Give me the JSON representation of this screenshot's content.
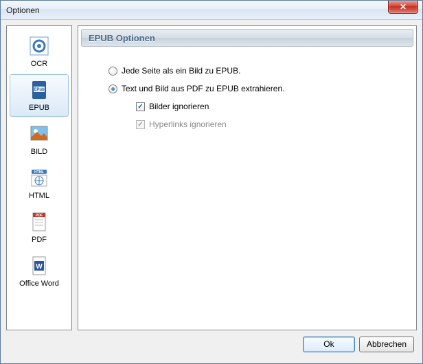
{
  "window": {
    "title": "Optionen"
  },
  "sidebar": {
    "items": [
      {
        "label": "OCR"
      },
      {
        "label": "EPUB"
      },
      {
        "label": "BILD"
      },
      {
        "label": "HTML"
      },
      {
        "label": "PDF"
      },
      {
        "label": "Office Word"
      }
    ],
    "selected_index": 1
  },
  "section": {
    "title": "EPUB Optionen"
  },
  "options": {
    "radio1": "Jede Seite als ein Bild zu EPUB.",
    "radio2": "Text und Bild aus PDF zu EPUB extrahieren.",
    "radio_selected": 2,
    "check_images": {
      "label": "Bilder ignorieren",
      "checked": true,
      "enabled": true
    },
    "check_links": {
      "label": "Hyperlinks ignorieren",
      "checked": true,
      "enabled": false
    }
  },
  "buttons": {
    "ok": "Ok",
    "cancel": "Abbrechen"
  },
  "colors": {
    "accent": "#1b5fa3",
    "titlebar_close": "#c62d1f"
  }
}
